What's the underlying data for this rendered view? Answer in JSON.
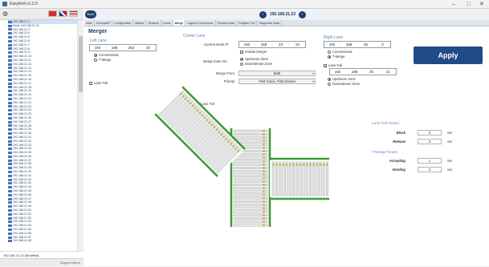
{
  "window": {
    "title": "EasyRoll v1.2.0",
    "controls": [
      "–",
      "□",
      "✕"
    ]
  },
  "sidebar": {
    "nodes": [
      "192.168.21.1",
      "Node 192.168.21.21",
      "192.168.21.3",
      "192.168.21.4",
      "192.168.21.5",
      "192.168.21.6",
      "192.168.21.7",
      "192.168.21.8",
      "192.168.21.9",
      "192.168.21.10",
      "192.168.21.11",
      "192.168.21.12",
      "192.168.21.13",
      "192.168.21.14",
      "192.168.21.15",
      "192.168.21.16",
      "192.168.21.17",
      "192.168.21.18",
      "192.168.21.19",
      "192.168.21.20",
      "192.168.21.21",
      "192.168.21.22",
      "192.168.21.23",
      "192.168.21.24",
      "192.168.21.25",
      "192.168.21.26",
      "192.168.21.27",
      "192.168.21.28",
      "192.168.21.29",
      "192.168.21.30",
      "192.168.21.31",
      "192.168.21.32",
      "192.168.21.33",
      "192.168.21.34",
      "192.168.21.35",
      "192.168.21.36",
      "192.168.21.37",
      "192.168.21.38",
      "192.168.21.39",
      "192.168.21.40",
      "192.168.21.41",
      "192.168.21.42",
      "192.168.21.43",
      "192.168.21.44",
      "192.168.21.45",
      "192.168.21.46",
      "192.168.21.47",
      "192.168.21.48",
      "192.168.21.49",
      "192.168.21.50",
      "192.168.21.51",
      "192.168.21.52",
      "192.168.21.53",
      "192.168.21.54",
      "192.168.21.55",
      "192.168.21.56",
      "192.168.21.57",
      "192.168.21.58"
    ],
    "footer_node": "192.168.21.23 (Modified)",
    "bottom_label": "Skipped Menu"
  },
  "header": {
    "back_label": "Back",
    "ip": "192.168.21.23"
  },
  "tabs": [
    "Main",
    "General/IP",
    "Configuration",
    "Motors",
    "Sensors",
    "Zones",
    "Merge",
    "Logical Connections",
    "Process Data",
    "Register Poll",
    "Diagnostic Data"
  ],
  "active_tab": "Merge",
  "page": {
    "title": "Merger",
    "left_lane": {
      "heading": "Left Lane",
      "ip": [
        "192",
        "168",
        "252",
        "20"
      ],
      "options": [
        "Conventional",
        "T-Merge"
      ],
      "lane_full_label": "Lane Full"
    },
    "center_lane": {
      "heading": "Center Lane",
      "current_node_ip_label": "Current Node IP:",
      "ip": [
        "192",
        "168",
        "23",
        "22"
      ],
      "enable_merger_label": "Enable Merger",
      "merge_zone_on_label": "Merge Zone On:",
      "merge_zone_options": [
        "Upstream Zone",
        "Downstream Zone"
      ],
      "merge_from_label": "Merge From:",
      "merge_from_value": "Both",
      "priority_label": "Priority:",
      "priority_value": "First Come, First Served",
      "lane_full_label": "Lane Full"
    },
    "right_lane": {
      "heading": "Right Lane",
      "ip": [
        "192",
        "168",
        "25",
        "2"
      ],
      "options": [
        "Conventional",
        "T-Merge"
      ],
      "lane_full_label": "Lane Full",
      "full_ip": [
        "192",
        "168",
        "25",
        "21"
      ],
      "zone_options": [
        "Upstream Zone",
        "Downstream Zone"
      ]
    },
    "apply_label": "Apply",
    "lane_full_timers": {
      "heading": "Lane Full Timers",
      "block_label": "Block",
      "block_value": "3",
      "release_label": "Release",
      "release_value": "3",
      "unit": "sec"
    },
    "tmerge_timers": {
      "heading": "T-Merge Timers",
      "accepting_label": "Accepting",
      "accepting_value": "1",
      "sending_label": "Sending",
      "sending_value": "2",
      "unit": "sec"
    }
  },
  "colors": {
    "accent": "#1f4b87",
    "conveyor_frame": "#3f9a3a",
    "roller": "#e6e6e6",
    "label": "#5a86bf"
  }
}
